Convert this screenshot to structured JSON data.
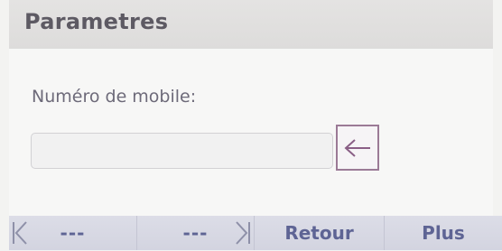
{
  "header": {
    "title": "Parametres"
  },
  "form": {
    "mobile_label": "Numéro de mobile:",
    "mobile_value": "",
    "backspace_icon": "arrow-left-icon"
  },
  "softkeys": {
    "key1_label": "---",
    "key2_label": "---",
    "key3_label": "Retour",
    "key4_label": "Plus",
    "first_icon": "skip-first-icon",
    "last_icon": "skip-last-icon"
  },
  "colors": {
    "title_text": "#5d5a63",
    "softkey_text": "#5e6494",
    "backspace_border": "#9b7a96"
  }
}
